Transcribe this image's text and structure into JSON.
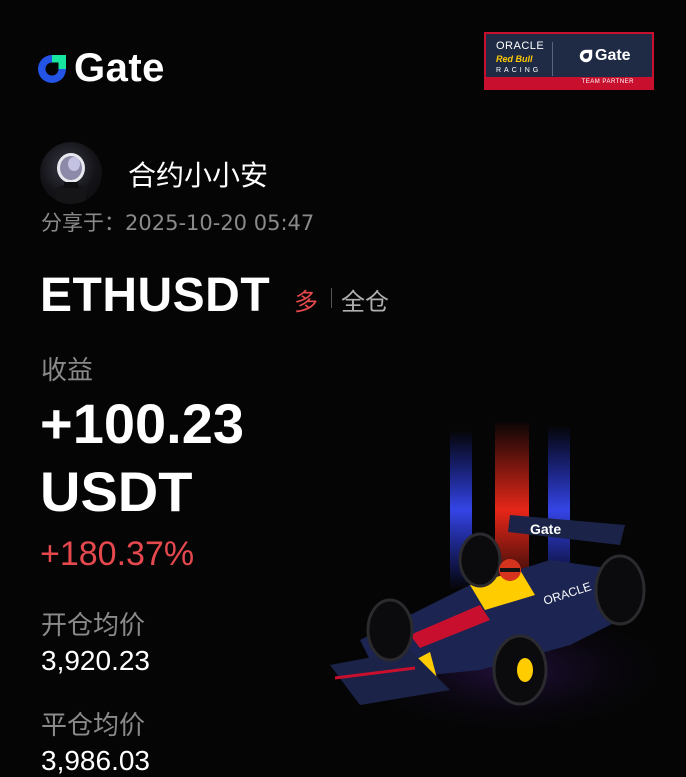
{
  "brand": {
    "name": "Gate",
    "icon": "gate-logo-icon"
  },
  "partner_badge": {
    "oracle": "ORACLE",
    "redbull": "Red Bull",
    "racing": "RACING",
    "gate": "Gate",
    "footer": "TEAM PARTNER"
  },
  "user": {
    "name": "合约小小安",
    "shared_at": "分享于：2025-10-20 05:47"
  },
  "position": {
    "symbol": "ETHUSDT",
    "direction": "多",
    "margin_mode": "全仓"
  },
  "pnl": {
    "label": "收益",
    "value": "+100.23",
    "unit": "USDT",
    "percent": "+180.37%"
  },
  "prices": {
    "entry_label": "开仓均价",
    "entry_value": "3,920.23",
    "exit_label": "平仓均价",
    "exit_value": "3,986.03"
  },
  "colors": {
    "accent_blue": "#2354e6",
    "accent_green": "#17e6a1",
    "loss_red": "#e5484d"
  }
}
